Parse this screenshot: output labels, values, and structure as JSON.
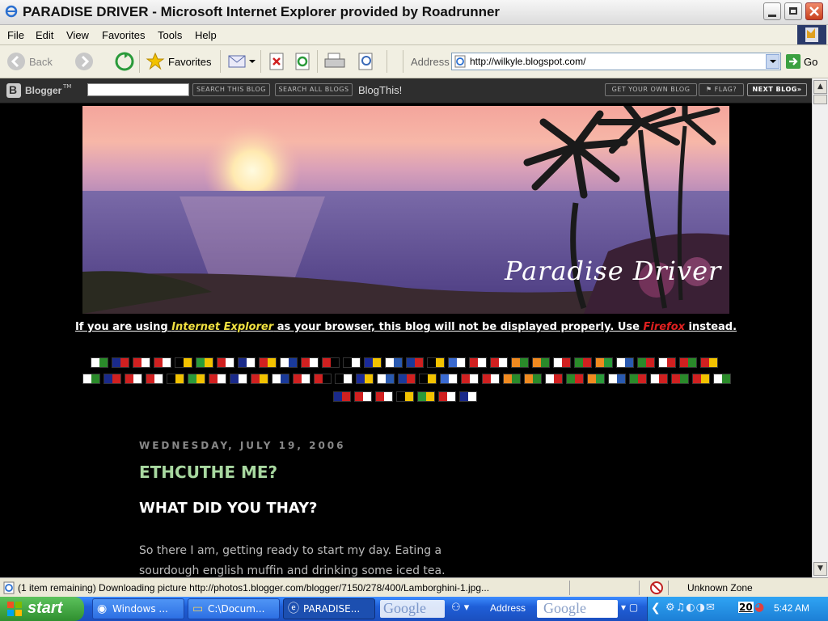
{
  "window": {
    "title": "PARADISE DRIVER - Microsoft Internet Explorer provided by Roadrunner"
  },
  "menu": [
    "File",
    "Edit",
    "View",
    "Favorites",
    "Tools",
    "Help"
  ],
  "toolbar": {
    "back": "Back",
    "favorites": "Favorites",
    "address_label": "Address",
    "address_value": "http://wilkyle.blogspot.com/",
    "go": "Go"
  },
  "blogger_bar": {
    "logo": "Blogger",
    "search_this": "SEARCH THIS BLOG",
    "search_all": "SEARCH ALL BLOGS",
    "blogthis": "BlogThis!",
    "get_own": "GET YOUR OWN BLOG",
    "flag": "FLAG?",
    "next_blog": "NEXT BLOG»"
  },
  "header": {
    "blog_title": "Paradise Driver"
  },
  "notice": {
    "part1": "If you are using ",
    "ie": "Internet Explorer",
    "part2": " as your browser, this blog will not be displayed properly. Use ",
    "ff": "Firefox",
    "part3": " instead."
  },
  "post": {
    "date": "WEDNESDAY, JULY 19, 2006",
    "title": "ETHCUTHE ME?",
    "subtitle": "WHAT DID YOU THAY?",
    "body1": "So there I am, getting ready to start my day. Eating a",
    "body2": "sourdough english muffin and drinking some iced tea."
  },
  "status": {
    "text": "(1 item remaining) Downloading picture http://photos1.blogger.com/blogger/7150/278/400/Lamborghini-1.jpg...",
    "zone": "Unknown Zone"
  },
  "taskbar": {
    "start": "start",
    "items": [
      "Windows ...",
      "C:\\Docum...",
      "PARADISE..."
    ],
    "address": "Address",
    "clock": "5:42 AM",
    "tray_num": "20"
  },
  "colors": {
    "notice_ie": "#f0e040",
    "notice_ff": "#e02020",
    "post_title": "#a8d8a0"
  }
}
